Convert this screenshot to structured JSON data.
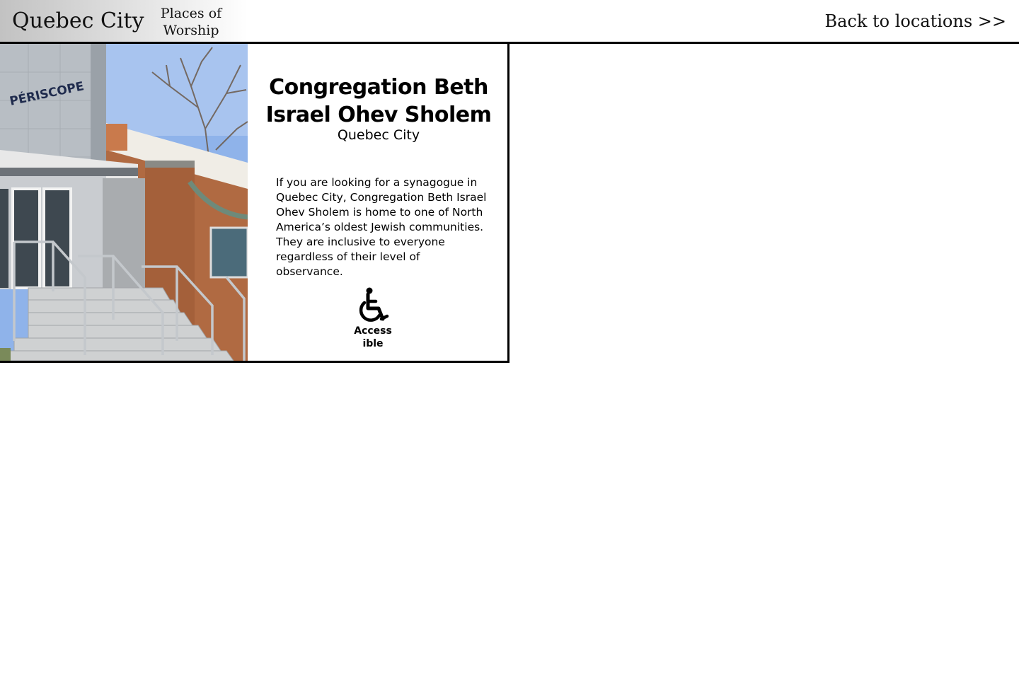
{
  "header": {
    "title": "Quebec City",
    "category": "Places of Worship",
    "back_link": "Back to locations >>"
  },
  "place": {
    "photo_sign_text": "PÉRISCOPE",
    "name": "Congregation Beth Israel Ohev Sholem",
    "city": "Quebec City",
    "description": "If you are looking for a synagogue in Quebec City, Congregation Beth Israel Ohev Sholem is home to one of North America’s oldest Jewish communities. They are inclusive to everyone regardless of their level of observance.",
    "features": [
      {
        "icon": "wheelchair-icon",
        "label": "Accessible"
      }
    ]
  },
  "colors": {
    "border": "#000000",
    "header_gradient_start": "#c2c2c2",
    "header_gradient_end": "#ffffff",
    "text": "#111111"
  }
}
